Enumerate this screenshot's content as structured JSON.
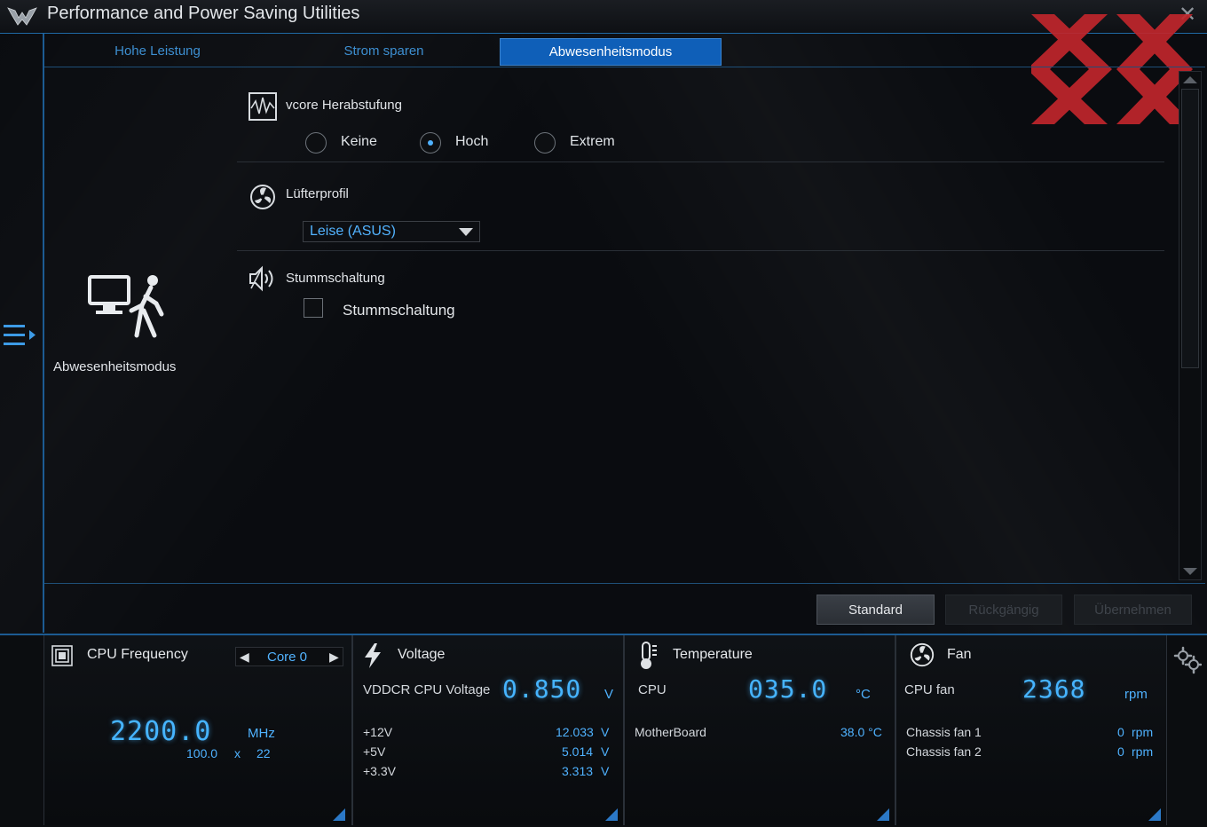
{
  "window": {
    "title": "Performance and Power Saving Utilities"
  },
  "tabs": [
    {
      "label": "Hohe Leistung",
      "active": false
    },
    {
      "label": "Strom sparen",
      "active": false
    },
    {
      "label": "Abwesenheitsmodus",
      "active": true
    }
  ],
  "mode": {
    "label": "Abwesenheitsmodus",
    "icon": "away-mode-icon"
  },
  "vcore": {
    "title": "vcore Herabstufung",
    "options": [
      {
        "label": "Keine",
        "checked": false
      },
      {
        "label": "Hoch",
        "checked": true
      },
      {
        "label": "Extrem",
        "checked": false
      }
    ]
  },
  "fan_profile": {
    "title": "Lüfterprofil",
    "selected": "Leise (ASUS)"
  },
  "mute": {
    "title": "Stummschaltung",
    "checkbox_label": "Stummschaltung",
    "checked": false
  },
  "buttons": {
    "standard": "Standard",
    "undo": "Rückgängig",
    "apply": "Übernehmen"
  },
  "monitor": {
    "cpu": {
      "title": "CPU Frequency",
      "core": "Core 0",
      "value": "2200.0",
      "unit": "MHz",
      "base": "100.0",
      "times": "x",
      "multiplier": "22"
    },
    "voltage": {
      "title": "Voltage",
      "main_label": "VDDCR CPU Voltage",
      "main_value": "0.850",
      "main_unit": "V",
      "rows": [
        {
          "label": "+12V",
          "value": "12.033",
          "unit": "V"
        },
        {
          "label": "+5V",
          "value": "5.014",
          "unit": "V"
        },
        {
          "label": "+3.3V",
          "value": "3.313",
          "unit": "V"
        }
      ]
    },
    "temperature": {
      "title": "Temperature",
      "main_label": "CPU",
      "main_value": "035.0",
      "main_unit": "°C",
      "rows": [
        {
          "label": "MotherBoard",
          "value": "38.0 °C"
        }
      ]
    },
    "fan": {
      "title": "Fan",
      "main_label": "CPU fan",
      "main_value": "2368",
      "main_unit": "rpm",
      "rows": [
        {
          "label": "Chassis fan 1",
          "value": "0",
          "unit": "rpm"
        },
        {
          "label": "Chassis fan 2",
          "value": "0",
          "unit": "rpm"
        }
      ]
    }
  },
  "colors": {
    "accent": "#0f5fb8",
    "lcd": "#46b4ff",
    "watermark": "#c0262c"
  }
}
